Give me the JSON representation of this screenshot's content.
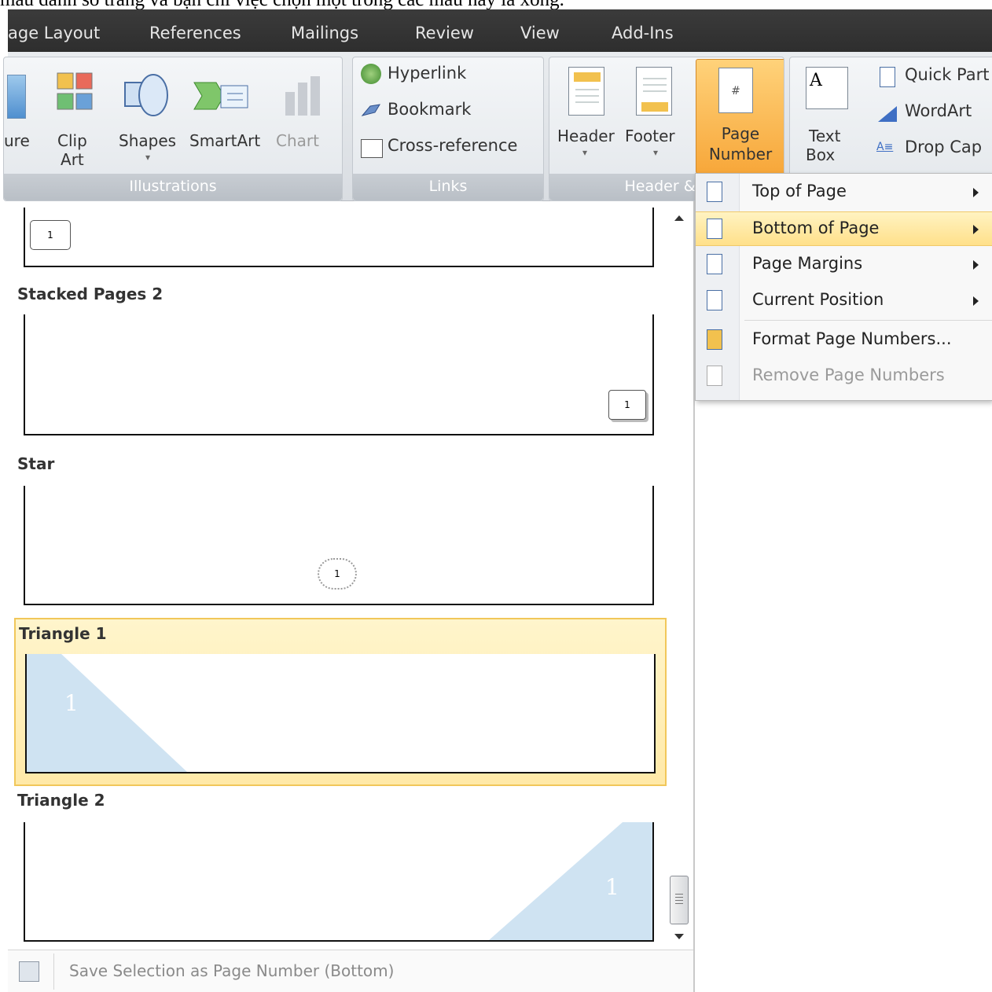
{
  "caption": "mẫu đánh số trang và bạn chỉ việc chọn một trong các mẫu này là xong.",
  "tabs": [
    "age Layout",
    "References",
    "Mailings",
    "Review",
    "View",
    "Add-Ins"
  ],
  "ribbon": {
    "illustrations": {
      "buttons": {
        "picture": "ure",
        "clipart": "Clip\nArt",
        "shapes": "Shapes",
        "smartart": "SmartArt",
        "chart": "Chart"
      },
      "label": "Illustrations"
    },
    "links": {
      "hyperlink": "Hyperlink",
      "bookmark": "Bookmark",
      "crossref": "Cross-reference",
      "label": "Links"
    },
    "header_footer": {
      "header": "Header",
      "footer": "Footer",
      "page_number_1": "Page",
      "page_number_2": "Number",
      "label": "Header & F"
    },
    "text": {
      "textbox_1": "Text",
      "textbox_2": "Box",
      "quickparts": "Quick Part",
      "wordart": "WordArt",
      "dropcap": "Drop Cap"
    }
  },
  "gallery": {
    "items": [
      {
        "label": "Stacked Pages 2",
        "number": "1"
      },
      {
        "label": "Star",
        "number": "1"
      },
      {
        "label": "Triangle 1",
        "number": "1"
      },
      {
        "label": "Triangle 2",
        "number": "1"
      }
    ],
    "top_partial_number": "1",
    "save_selection": "Save Selection as Page Number (Bottom)"
  },
  "menu": {
    "items": [
      {
        "label": "Top of Page",
        "submenu": true
      },
      {
        "label": "Bottom of Page",
        "submenu": true
      },
      {
        "label": "Page Margins",
        "submenu": true
      },
      {
        "label": "Current Position",
        "submenu": true
      },
      {
        "label": "Format Page Numbers...",
        "submenu": false
      },
      {
        "label": "Remove Page Numbers",
        "submenu": false
      }
    ]
  },
  "colors": {
    "highlight": "#ffe08a",
    "triangle": "#cfe3f2",
    "ribbon_tab": "#2f2f2f"
  }
}
